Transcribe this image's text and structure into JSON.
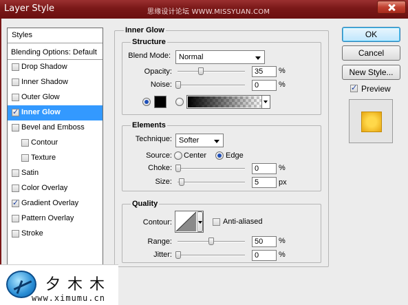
{
  "window": {
    "title": "Layer Style",
    "watermark": "思缘设计论坛 WWW.MISSYUAN.COM"
  },
  "styles_panel": {
    "header": "Styles",
    "blending_options": "Blending Options: Default",
    "items": [
      {
        "label": "Drop Shadow",
        "checked": false,
        "sub": false,
        "selected": false
      },
      {
        "label": "Inner Shadow",
        "checked": false,
        "sub": false,
        "selected": false
      },
      {
        "label": "Outer Glow",
        "checked": false,
        "sub": false,
        "selected": false
      },
      {
        "label": "Inner Glow",
        "checked": true,
        "sub": false,
        "selected": true
      },
      {
        "label": "Bevel and Emboss",
        "checked": false,
        "sub": false,
        "selected": false
      },
      {
        "label": "Contour",
        "checked": false,
        "sub": true,
        "selected": false
      },
      {
        "label": "Texture",
        "checked": false,
        "sub": true,
        "selected": false
      },
      {
        "label": "Satin",
        "checked": false,
        "sub": false,
        "selected": false
      },
      {
        "label": "Color Overlay",
        "checked": false,
        "sub": false,
        "selected": false
      },
      {
        "label": "Gradient Overlay",
        "checked": true,
        "sub": false,
        "selected": false
      },
      {
        "label": "Pattern Overlay",
        "checked": false,
        "sub": false,
        "selected": false
      },
      {
        "label": "Stroke",
        "checked": false,
        "sub": false,
        "selected": false
      }
    ]
  },
  "inner_glow": {
    "title": "Inner Glow",
    "structure": {
      "title": "Structure",
      "blend_mode_label": "Blend Mode:",
      "blend_mode_value": "Normal",
      "opacity_label": "Opacity:",
      "opacity_value": "35",
      "opacity_unit": "%",
      "opacity_percent": 35,
      "noise_label": "Noise:",
      "noise_value": "0",
      "noise_unit": "%",
      "noise_percent": 0,
      "glow_color": "#000000",
      "color_radio_selected": "color"
    },
    "elements": {
      "title": "Elements",
      "technique_label": "Technique:",
      "technique_value": "Softer",
      "source_label": "Source:",
      "source_center": "Center",
      "source_edge": "Edge",
      "source_selected": "edge",
      "choke_label": "Choke:",
      "choke_value": "0",
      "choke_unit": "%",
      "choke_percent": 0,
      "size_label": "Size:",
      "size_value": "5",
      "size_unit": "px"
    },
    "quality": {
      "title": "Quality",
      "contour_label": "Contour:",
      "anti_aliased_label": "Anti-aliased",
      "anti_aliased_checked": false,
      "range_label": "Range:",
      "range_value": "50",
      "range_unit": "%",
      "range_percent": 50,
      "jitter_label": "Jitter:",
      "jitter_value": "0",
      "jitter_unit": "%",
      "jitter_percent": 0
    }
  },
  "buttons": {
    "ok": "OK",
    "cancel": "Cancel",
    "new_style": "New Style...",
    "preview_label": "Preview",
    "preview_checked": true
  },
  "logo": {
    "chinese": "夕木木",
    "url": "www.ximumu.cn"
  }
}
